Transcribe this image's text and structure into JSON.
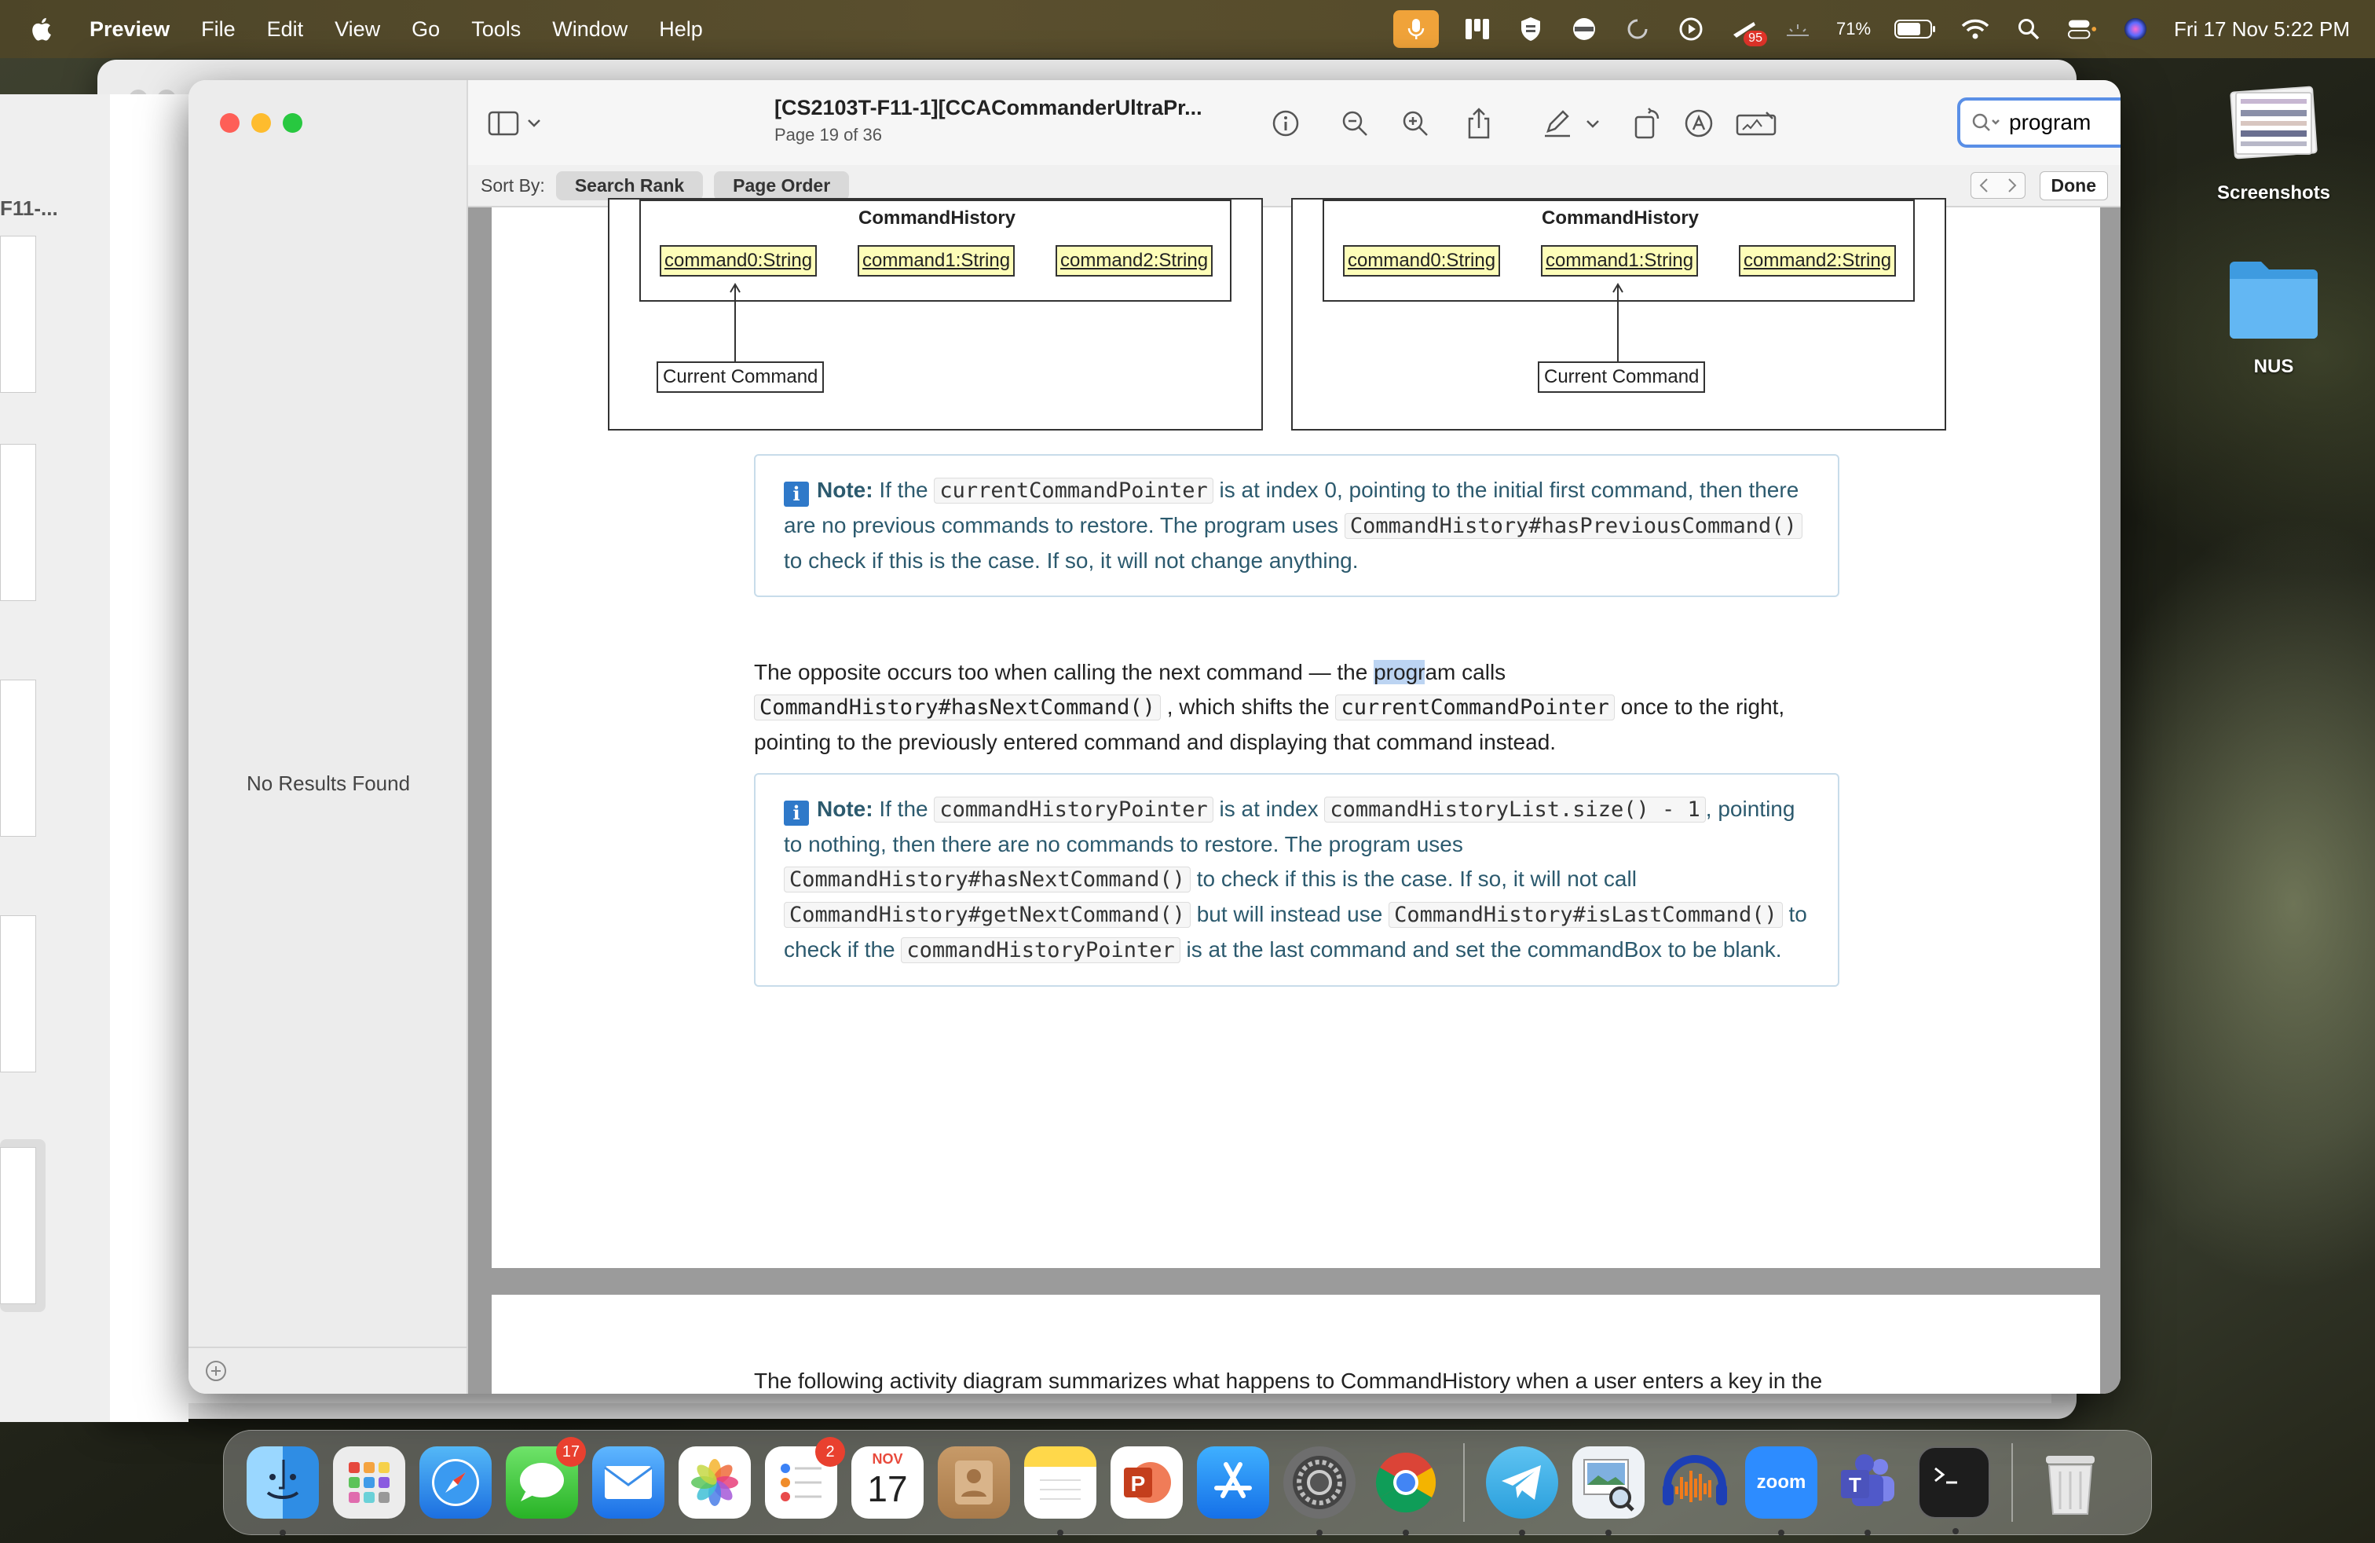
{
  "menubar": {
    "app_name": "Preview",
    "items": [
      "File",
      "Edit",
      "View",
      "Go",
      "Tools",
      "Window",
      "Help"
    ],
    "battery": "71%",
    "datetime": "Fri 17 Nov  5:22 PM",
    "notification_count": "95"
  },
  "desktop": {
    "screenshots_label": "Screenshots",
    "nus_label": "NUS"
  },
  "back_window": {
    "title_fragment": "F11-..."
  },
  "window": {
    "title": "[CS2103T-F11-1][CCACommanderUltraPr...",
    "subtitle": "Page 19 of 36",
    "search_value": "program",
    "sort_by_label": "Sort By:",
    "sort_search_rank": "Search Rank",
    "sort_page_order": "Page Order",
    "done_label": "Done",
    "no_results": "No Results Found"
  },
  "document": {
    "diagram_left": {
      "title": "CommandHistory",
      "cells": [
        "command0:String",
        "command1:String",
        "command2:String"
      ],
      "pointer": "Current Command"
    },
    "diagram_right": {
      "title": "CommandHistory",
      "cells": [
        "command0:String",
        "command1:String",
        "command2:String"
      ],
      "pointer": "Current Command"
    },
    "note1": {
      "label": "Note:",
      "t1": " If the ",
      "c1": "currentCommandPointer",
      "t2": " is at index 0, pointing to the initial first command, then there are no previous commands to restore. The program uses ",
      "c2": "CommandHistory#hasPreviousCommand()",
      "t3": " to check if this is the case. If so, it will not change anything."
    },
    "para1": {
      "t1": "The opposite occurs too when calling the next command — the ",
      "highlight": "progr",
      "t2": "am calls ",
      "c1": "CommandHistory#hasNextCommand()",
      "t3": " , which shifts the ",
      "c2": "currentCommandPointer",
      "t4": " once to the right, pointing to the previously entered command and displaying that command instead."
    },
    "note2": {
      "label": "Note:",
      "t1": " If the ",
      "c1": "commandHistoryPointer",
      "t2": " is at index ",
      "c2": "commandHistoryList.size() - 1",
      "t3": ", pointing to nothing, then there are no commands to restore. The program uses ",
      "c3": "CommandHistory#hasNextCommand()",
      "t4": " to check if this is the case. If so, it will not call ",
      "c4": "CommandHistory#getNextCommand()",
      "t5": " but will instead use ",
      "c5": "CommandHistory#isLastCommand()",
      "t6": " to check if the ",
      "c6": "commandHistoryPointer",
      "t7": " is at the last command and set the commandBox to be blank."
    },
    "para2": "The following activity diagram summarizes what happens to CommandHistory when a user enters a key in the commandBox:"
  },
  "dock": {
    "messages_badge": "17",
    "reminders_badge": "2",
    "calendar_month": "NOV",
    "calendar_day": "17",
    "zoom_label": "zoom"
  }
}
